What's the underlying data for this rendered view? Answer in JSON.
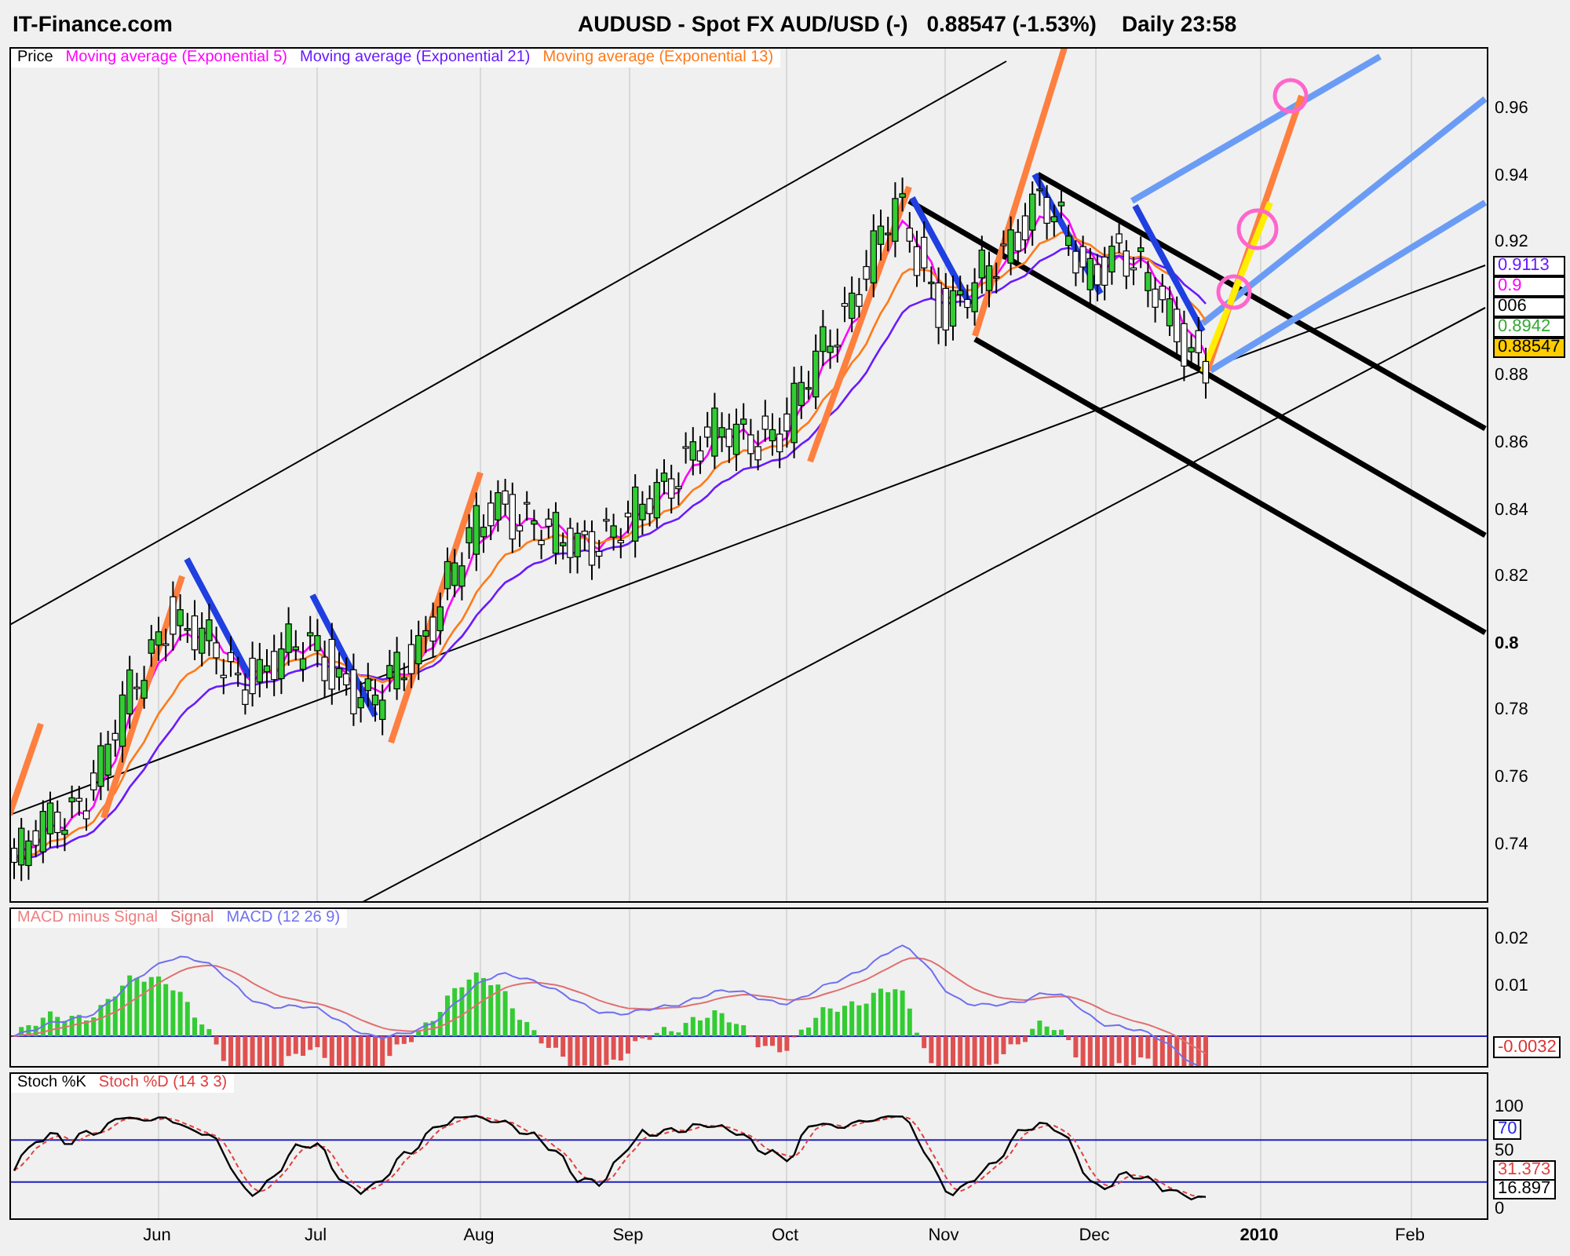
{
  "header": {
    "site": "IT-Finance.com",
    "title": "AUDUSD - Spot FX AUD/USD (-)",
    "price": "0.88547 (-1.53%)",
    "period": "Daily",
    "time": "23:58"
  },
  "price_panel": {
    "legend": [
      {
        "label": "Price",
        "color": "#000000"
      },
      {
        "label": "Moving average (Exponential 5)",
        "color": "#ff00ff"
      },
      {
        "label": "Moving average (Exponential 21)",
        "color": "#6a1aff"
      },
      {
        "label": "Moving average (Exponential 13)",
        "color": "#ff7a1a"
      }
    ],
    "y_axis": [
      {
        "label": "0.96",
        "bold": false
      },
      {
        "label": "0.94",
        "bold": false
      },
      {
        "label": "0.92",
        "bold": false
      },
      {
        "label": "0.88",
        "bold": false
      },
      {
        "label": "0.86",
        "bold": false
      },
      {
        "label": "0.84",
        "bold": false
      },
      {
        "label": "0.82",
        "bold": false
      },
      {
        "label": "0.8",
        "bold": true
      },
      {
        "label": "0.78",
        "bold": false
      },
      {
        "label": "0.76",
        "bold": false
      },
      {
        "label": "0.74",
        "bold": false
      }
    ],
    "markers": [
      {
        "label": "0.9113",
        "color": "#6a1aff",
        "kind": "box"
      },
      {
        "label": "0.9",
        "color": "#ff00ff",
        "kind": "box"
      },
      {
        "label": "006",
        "color": "#000000",
        "kind": "box"
      },
      {
        "label": "0.8942",
        "color": "#33aa33",
        "kind": "box"
      },
      {
        "label": "0.88547",
        "color": "#000000",
        "kind": "current"
      }
    ]
  },
  "macd_panel": {
    "legend": [
      {
        "label": "MACD minus Signal",
        "color": "#f08080"
      },
      {
        "label": "Signal",
        "color": "#e07070"
      },
      {
        "label": "MACD (12 26 9)",
        "color": "#7070f0"
      }
    ],
    "y_axis": [
      "0.02",
      "0.01"
    ],
    "markers": [
      {
        "label": "-0.0032",
        "color": "#dd3333"
      }
    ]
  },
  "stoch_panel": {
    "legend": [
      {
        "label": "Stoch %K",
        "color": "#000000"
      },
      {
        "label": "Stoch %D (14 3 3)",
        "color": "#e04040"
      }
    ],
    "y_axis": [
      "100",
      "50",
      "0"
    ],
    "markers": [
      {
        "label": "70",
        "color": "#2222ee"
      },
      {
        "label": "31.373",
        "color": "#e04040"
      },
      {
        "label": "16.897",
        "color": "#000000"
      }
    ]
  },
  "x_axis": [
    {
      "label": "Jun",
      "bold": false
    },
    {
      "label": "Jul",
      "bold": false
    },
    {
      "label": "Aug",
      "bold": false
    },
    {
      "label": "Sep",
      "bold": false
    },
    {
      "label": "Oct",
      "bold": false
    },
    {
      "label": "Nov",
      "bold": false
    },
    {
      "label": "Dec",
      "bold": false
    },
    {
      "label": "2010",
      "bold": true
    },
    {
      "label": "Feb",
      "bold": false
    }
  ]
}
